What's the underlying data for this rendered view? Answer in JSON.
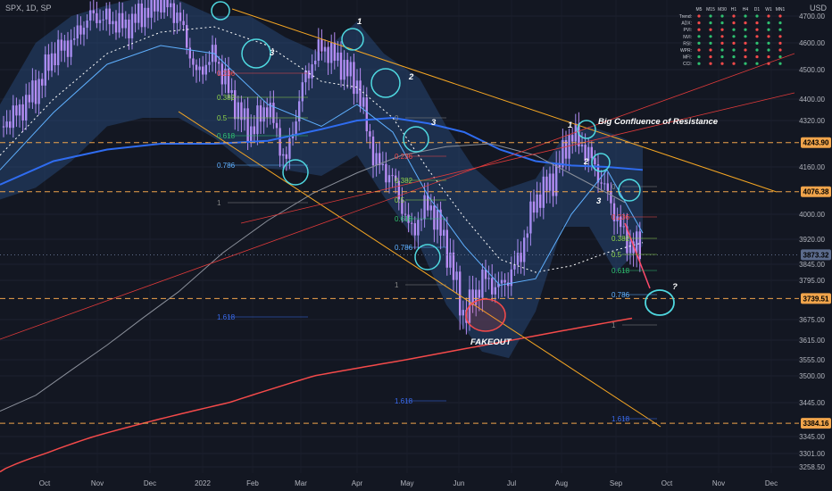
{
  "header": {
    "symbol": "SPX, 1D, SP",
    "currency": "USD"
  },
  "annotations": {
    "resistance": "Big Confluence of Resistance",
    "fakeout": "FAKEOUT",
    "question": "?",
    "wave_top": [
      "1",
      "2",
      "3"
    ],
    "wave_right": [
      "1",
      "2",
      "3"
    ],
    "wave_left3": "3"
  },
  "fib_left": [
    "0.236",
    "0.382",
    "0.5",
    "0.618",
    "0.786",
    "1",
    "1.618"
  ],
  "fib_mid": [
    "0",
    "0.236",
    "0.382",
    "0.5",
    "0.618",
    "0.786",
    "1",
    "1.618"
  ],
  "fib_right": [
    "0",
    "0.236",
    "0.382",
    "0.5",
    "0.618",
    "0.786",
    "1",
    "1.618"
  ],
  "price_tags": [
    {
      "value": 4243.9,
      "label": "4243.90",
      "color": "#f0a44b"
    },
    {
      "value": 4076.38,
      "label": "4076.38",
      "color": "#f0a44b"
    },
    {
      "value": 3873.32,
      "label": "3873.32",
      "color": "#5b6b8c"
    },
    {
      "value": 3739.51,
      "label": "3739.51",
      "color": "#f0a44b"
    },
    {
      "value": 3384.16,
      "label": "3384.16",
      "color": "#f0a44b"
    }
  ],
  "indicator_table": {
    "columns": [
      "M5",
      "M15",
      "M30",
      "H1",
      "H4",
      "D1",
      "W1",
      "MN1"
    ],
    "rows": [
      "Trend:",
      "ADX:",
      "PVI:",
      "NVI:",
      "RSI:",
      "WPR:",
      "MFI:",
      "CCI:"
    ]
  },
  "chart_data": {
    "type": "candlestick",
    "title": "SPX, 1D, SP",
    "y_ticks": [
      4700.0,
      4600.0,
      4500.0,
      4400.0,
      4320.0,
      4160.0,
      4000.0,
      3920.0,
      3845.0,
      3795.0,
      3675.0,
      3615.0,
      3555.0,
      3500.0,
      3445.0,
      3345.0,
      3301.0,
      3258.5
    ],
    "y_tick_labels": [
      "4700.00",
      "4600.00",
      "4500.00",
      "4400.00",
      "4320.00",
      "4160.00",
      "4000.00",
      "3920.00",
      "3845.00",
      "3795.00",
      "3675.00",
      "3615.00",
      "3555.00",
      "3500.00",
      "3445.00",
      "3345.00",
      "3301.00",
      "3258.50"
    ],
    "x_labels": [
      "Oct",
      "Nov",
      "Dec",
      "2022",
      "Feb",
      "Mar",
      "Apr",
      "May",
      "Jun",
      "Jul",
      "Aug",
      "Sep",
      "Oct",
      "Nov",
      "Dec"
    ],
    "ylim": [
      3230,
      4760
    ],
    "close_path": [
      [
        0,
        4300
      ],
      [
        6,
        4350
      ],
      [
        10,
        4430
      ],
      [
        14,
        4560
      ],
      [
        18,
        4600
      ],
      [
        22,
        4700
      ],
      [
        26,
        4690
      ],
      [
        30,
        4660
      ],
      [
        34,
        4710
      ],
      [
        38,
        4760
      ],
      [
        42,
        4700
      ],
      [
        46,
        4480
      ],
      [
        50,
        4560
      ],
      [
        54,
        4400
      ],
      [
        58,
        4280
      ],
      [
        62,
        4380
      ],
      [
        66,
        4170
      ],
      [
        70,
        4460
      ],
      [
        74,
        4590
      ],
      [
        78,
        4530
      ],
      [
        82,
        4450
      ],
      [
        86,
        4180
      ],
      [
        90,
        4120
      ],
      [
        94,
        3940
      ],
      [
        98,
        4040
      ],
      [
        102,
        3900
      ],
      [
        106,
        3680
      ],
      [
        110,
        3800
      ],
      [
        114,
        3770
      ],
      [
        118,
        3850
      ],
      [
        122,
        4050
      ],
      [
        126,
        4120
      ],
      [
        130,
        4280
      ],
      [
        134,
        4200
      ],
      [
        138,
        4070
      ],
      [
        142,
        3920
      ],
      [
        146,
        3880
      ]
    ]
  }
}
